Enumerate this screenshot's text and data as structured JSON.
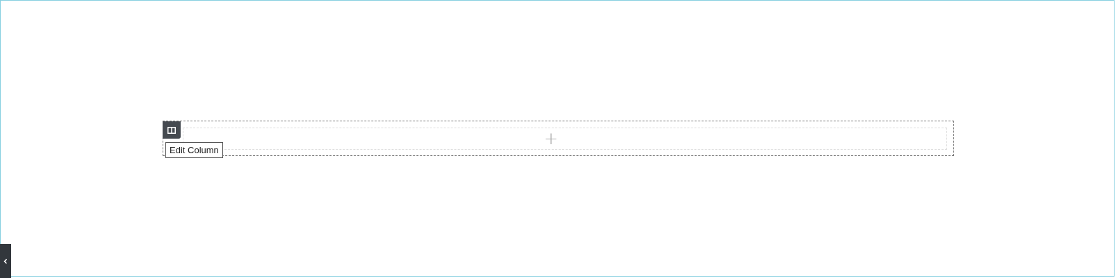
{
  "column": {
    "add_symbol": "+",
    "tooltip": "Edit Column"
  }
}
